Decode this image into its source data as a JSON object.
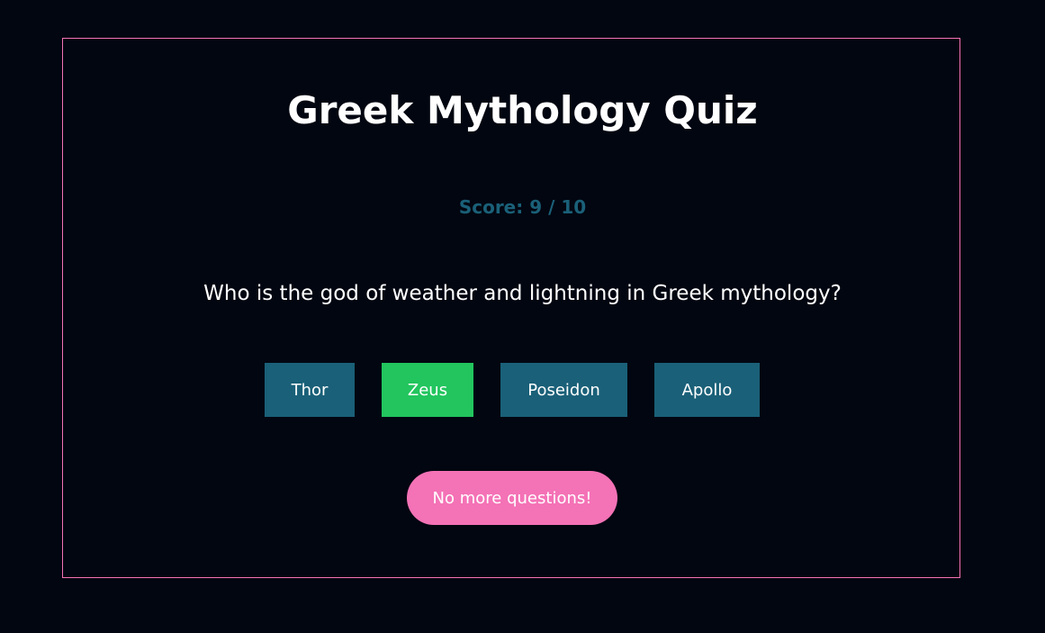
{
  "quiz": {
    "title": "Greek Mythology Quiz",
    "score_label": "Score: 9 / 10",
    "question": "Who is the god of weather and lightning in Greek mythology?",
    "answers": [
      {
        "label": "Thor",
        "state": "default"
      },
      {
        "label": "Zeus",
        "state": "correct"
      },
      {
        "label": "Poseidon",
        "state": "default"
      },
      {
        "label": "Apollo",
        "state": "default"
      }
    ],
    "next_button_label": "No more questions!"
  },
  "colors": {
    "background": "#020611",
    "card_border": "#f472b6",
    "answer_default": "#1a6078",
    "answer_correct": "#22c55e",
    "score_text": "#1a6078",
    "next_button": "#f472b6"
  }
}
